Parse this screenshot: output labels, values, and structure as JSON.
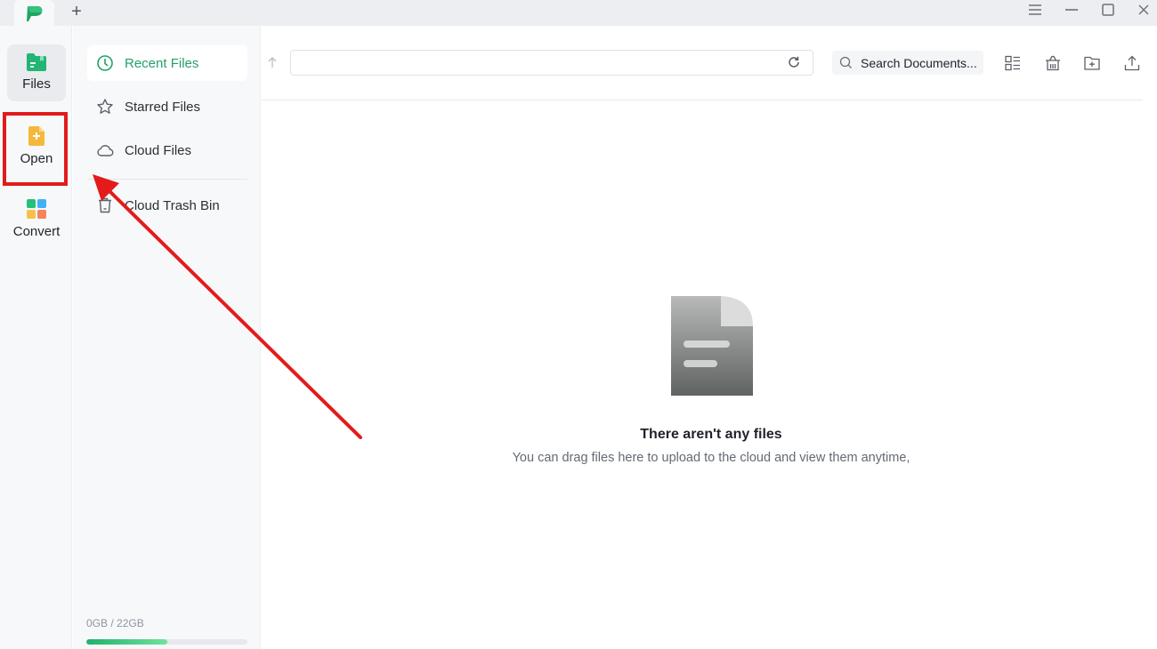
{
  "titlebar": {
    "app_logo": "app-logo",
    "new_tab_label": "+",
    "window_controls": [
      "menu",
      "minimize",
      "maximize",
      "close"
    ]
  },
  "rail": {
    "items": [
      {
        "label": "Files",
        "icon": "folder-icon",
        "active": true
      },
      {
        "label": "Open",
        "icon": "open-file-icon",
        "active": false
      },
      {
        "label": "Convert",
        "icon": "convert-icon",
        "active": false
      }
    ]
  },
  "nav": {
    "items": [
      {
        "label": "Recent Files",
        "icon": "clock-icon",
        "active": true
      },
      {
        "label": "Starred Files",
        "icon": "star-icon",
        "active": false
      },
      {
        "label": "Cloud Files",
        "icon": "cloud-icon",
        "active": false
      },
      {
        "label": "Cloud Trash Bin",
        "icon": "trash-icon",
        "active": false
      }
    ],
    "storage": {
      "text": "0GB / 22GB",
      "used_fraction": 0.5
    }
  },
  "toolbar": {
    "path_value": "",
    "search_placeholder": "Search Documents...",
    "tools": [
      "list-view",
      "trash-bin",
      "new-folder",
      "upload"
    ]
  },
  "empty_state": {
    "title": "There aren't any files",
    "subtitle": "You can drag files here to upload to the cloud and view them anytime,"
  },
  "colors": {
    "accent": "#22a06b",
    "annotation": "#e31b1b"
  }
}
